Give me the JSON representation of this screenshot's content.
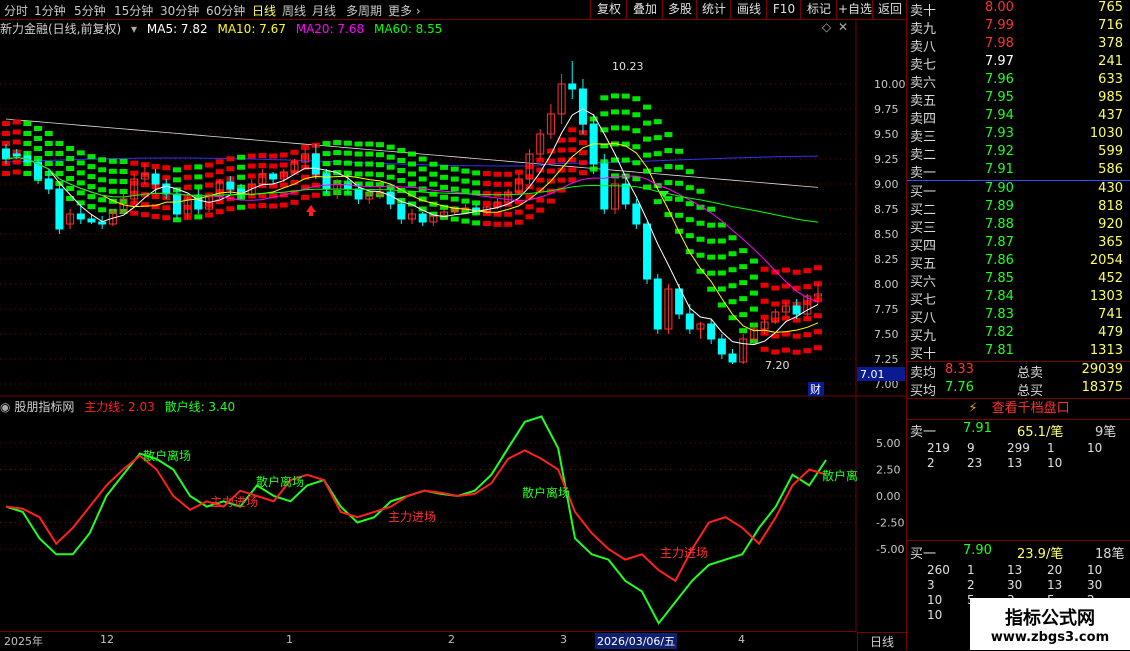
{
  "toolbar": {
    "periods": [
      "分时",
      "1分钟",
      "5分钟",
      "15分钟",
      "30分钟",
      "60分钟",
      "日线",
      "周线",
      "月线",
      "多周期",
      "更多"
    ],
    "active": "日线",
    "right_buttons": [
      "复权",
      "叠加",
      "多股",
      "统计",
      "画线",
      "F10",
      "标记",
      "+自选",
      "返回"
    ]
  },
  "title": {
    "stock": "新力金融(日线,前复权)",
    "ma5": "MA5: 7.82",
    "ma10": "MA10: 7.67",
    "ma20": "MA20: 7.68",
    "ma60": "MA60: 8.55"
  },
  "colors": {
    "up": "#ff3232",
    "down": "#00ffff",
    "ma5": "#ffffff",
    "ma10": "#ffff00",
    "ma20": "#ff00ff",
    "ma60": "#00ff00",
    "grid": "#7a0000",
    "line_main": "#ff2020",
    "line_retail": "#20ff20",
    "ribbon_green": "#00ff00",
    "ribbon_red": "#ff0000"
  },
  "price_axis": {
    "ticks": [
      "10.00",
      "9.75",
      "9.50",
      "9.25",
      "9.00",
      "8.75",
      "8.50",
      "8.25",
      "8.00",
      "7.75",
      "7.50",
      "7.25",
      "7.00"
    ],
    "current": "7.01"
  },
  "annotations": {
    "high": "10.23",
    "low": "7.20",
    "cai": "财"
  },
  "indicator": {
    "title": "股朋指标网",
    "main_label": "主力线: 2.03",
    "retail_label": "散户线: 3.40",
    "ticks": [
      "5.00",
      "2.50",
      "0.00",
      "-2.50",
      "-5.00"
    ],
    "labels": [
      {
        "text": "散户离场"
      },
      {
        "text": "主力进场"
      },
      {
        "text": "散户离场"
      },
      {
        "text": "主力进场"
      },
      {
        "text": "散户离场"
      },
      {
        "text": "主力进场"
      },
      {
        "text": "散户离"
      }
    ]
  },
  "xaxis": {
    "labels": [
      "2025年",
      "12",
      "1",
      "2",
      "3",
      "2026/03/06/五",
      "4"
    ],
    "period": "日线"
  },
  "orderbook": {
    "asks": [
      {
        "label": "卖十",
        "price": "8.00",
        "vol": "765"
      },
      {
        "label": "卖九",
        "price": "7.99",
        "vol": "716"
      },
      {
        "label": "卖八",
        "price": "7.98",
        "vol": "378"
      },
      {
        "label": "卖七",
        "price": "7.97",
        "vol": "241"
      },
      {
        "label": "卖六",
        "price": "7.96",
        "vol": "633"
      },
      {
        "label": "卖五",
        "price": "7.95",
        "vol": "985"
      },
      {
        "label": "卖四",
        "price": "7.94",
        "vol": "437"
      },
      {
        "label": "卖三",
        "price": "7.93",
        "vol": "1030"
      },
      {
        "label": "卖二",
        "price": "7.92",
        "vol": "599"
      },
      {
        "label": "卖一",
        "price": "7.91",
        "vol": "586"
      }
    ],
    "bids": [
      {
        "label": "买一",
        "price": "7.90",
        "vol": "430"
      },
      {
        "label": "买二",
        "price": "7.89",
        "vol": "818"
      },
      {
        "label": "买三",
        "price": "7.88",
        "vol": "920"
      },
      {
        "label": "买四",
        "price": "7.87",
        "vol": "365"
      },
      {
        "label": "买五",
        "price": "7.86",
        "vol": "2054"
      },
      {
        "label": "买六",
        "price": "7.85",
        "vol": "452"
      },
      {
        "label": "买七",
        "price": "7.84",
        "vol": "1303"
      },
      {
        "label": "买八",
        "price": "7.83",
        "vol": "741"
      },
      {
        "label": "买九",
        "price": "7.82",
        "vol": "479"
      },
      {
        "label": "买十",
        "price": "7.81",
        "vol": "1313"
      }
    ],
    "avg_sell": {
      "label": "卖均",
      "price": "8.33",
      "total_label": "总卖",
      "total": "29039"
    },
    "avg_buy": {
      "label": "买均",
      "price": "7.76",
      "total_label": "总买",
      "total": "18375"
    },
    "view_button": "查看千档盘口",
    "sell1_summary": {
      "label": "卖一",
      "price": "7.91",
      "per": "65.1/笔",
      "count": "9笔"
    },
    "sell1_orders": [
      "219",
      "9",
      "299",
      "1",
      "10",
      "2",
      "23",
      "13",
      "10"
    ],
    "buy1_summary": {
      "label": "买一",
      "price": "7.90",
      "per": "23.9/笔",
      "count": "18笔"
    },
    "buy1_orders": [
      "260",
      "1",
      "13",
      "20",
      "10",
      "3",
      "2",
      "30",
      "13",
      "30",
      "10",
      "5",
      "3",
      "5",
      "2",
      "10"
    ]
  },
  "watermark": {
    "line1": "指标公式网",
    "line2": "www.zbgs3.com"
  },
  "chart_data": {
    "type": "candlestick",
    "title": "新力金融(日线,前复权)",
    "ylim": [
      7.0,
      10.3
    ],
    "candles": [
      [
        9.35,
        9.4,
        9.25,
        9.2
      ],
      [
        9.3,
        9.35,
        9.28,
        9.25
      ],
      [
        9.28,
        9.32,
        9.22,
        9.18
      ],
      [
        9.22,
        9.25,
        9.05,
        9.0
      ],
      [
        9.05,
        9.15,
        8.95,
        8.9
      ],
      [
        8.95,
        9.0,
        8.55,
        8.5
      ],
      [
        8.6,
        8.75,
        8.7,
        8.55
      ],
      [
        8.7,
        8.8,
        8.65,
        8.6
      ],
      [
        8.65,
        8.7,
        8.62,
        8.6
      ],
      [
        8.62,
        8.68,
        8.6,
        8.55
      ],
      [
        8.6,
        8.75,
        8.72,
        8.58
      ],
      [
        8.72,
        8.9,
        8.85,
        8.7
      ],
      [
        8.85,
        9.1,
        9.05,
        8.8
      ],
      [
        9.05,
        9.2,
        9.1,
        9.0
      ],
      [
        9.1,
        9.15,
        9.0,
        8.9
      ],
      [
        9.0,
        9.05,
        8.9,
        8.85
      ],
      [
        8.9,
        8.95,
        8.7,
        8.65
      ],
      [
        8.7,
        8.9,
        8.85,
        8.65
      ],
      [
        8.85,
        8.95,
        8.75,
        8.7
      ],
      [
        8.75,
        8.9,
        8.88,
        8.72
      ],
      [
        8.88,
        9.05,
        9.02,
        8.85
      ],
      [
        9.02,
        9.08,
        8.95,
        8.9
      ],
      [
        8.95,
        9.0,
        8.9,
        8.85
      ],
      [
        8.9,
        9.05,
        9.0,
        8.88
      ],
      [
        9.0,
        9.15,
        9.1,
        8.98
      ],
      [
        9.1,
        9.12,
        9.05,
        9.0
      ],
      [
        9.05,
        9.15,
        9.12,
        9.02
      ],
      [
        9.12,
        9.25,
        9.22,
        9.1
      ],
      [
        9.22,
        9.35,
        9.3,
        9.15
      ],
      [
        9.3,
        9.4,
        9.1,
        9.05
      ],
      [
        9.1,
        9.15,
        8.95,
        8.9
      ],
      [
        8.95,
        9.05,
        9.0,
        8.85
      ],
      [
        9.0,
        9.1,
        8.95,
        8.9
      ],
      [
        8.95,
        9.0,
        8.85,
        8.8
      ],
      [
        8.85,
        8.95,
        8.9,
        8.8
      ],
      [
        8.9,
        9.0,
        8.92,
        8.85
      ],
      [
        8.92,
        8.95,
        8.8,
        8.75
      ],
      [
        8.8,
        8.85,
        8.65,
        8.6
      ],
      [
        8.65,
        8.75,
        8.7,
        8.6
      ],
      [
        8.7,
        8.72,
        8.62,
        8.58
      ],
      [
        8.62,
        8.7,
        8.68,
        8.58
      ],
      [
        8.68,
        8.75,
        8.72,
        8.65
      ],
      [
        8.72,
        8.78,
        8.74,
        8.7
      ],
      [
        8.74,
        8.8,
        8.76,
        8.72
      ],
      [
        8.76,
        8.8,
        8.73,
        8.7
      ],
      [
        8.73,
        8.78,
        8.77,
        8.7
      ],
      [
        8.77,
        8.85,
        8.82,
        8.75
      ],
      [
        8.82,
        8.95,
        8.92,
        8.8
      ],
      [
        8.92,
        9.1,
        9.05,
        8.9
      ],
      [
        9.05,
        9.35,
        9.3,
        9.0
      ],
      [
        9.3,
        9.55,
        9.5,
        9.25
      ],
      [
        9.5,
        9.8,
        9.7,
        9.45
      ],
      [
        9.7,
        10.1,
        10.0,
        9.6
      ],
      [
        10.0,
        10.23,
        9.95,
        9.85
      ],
      [
        9.95,
        10.05,
        9.6,
        9.5
      ],
      [
        9.6,
        9.7,
        9.2,
        9.1
      ],
      [
        9.2,
        9.3,
        8.75,
        8.7
      ],
      [
        8.75,
        9.05,
        9.0,
        8.7
      ],
      [
        9.0,
        9.1,
        8.8,
        8.75
      ],
      [
        8.8,
        8.85,
        8.6,
        8.55
      ],
      [
        8.6,
        8.62,
        8.05,
        8.0
      ],
      [
        8.05,
        8.1,
        7.55,
        7.5
      ],
      [
        7.55,
        8.0,
        7.95,
        7.5
      ],
      [
        7.95,
        8.0,
        7.7,
        7.65
      ],
      [
        7.7,
        7.8,
        7.55,
        7.5
      ],
      [
        7.55,
        7.62,
        7.6,
        7.45
      ],
      [
        7.6,
        7.65,
        7.45,
        7.4
      ],
      [
        7.45,
        7.5,
        7.3,
        7.25
      ],
      [
        7.3,
        7.35,
        7.22,
        7.2
      ],
      [
        7.22,
        7.5,
        7.45,
        7.2
      ],
      [
        7.45,
        7.6,
        7.55,
        7.4
      ],
      [
        7.55,
        7.65,
        7.62,
        7.5
      ],
      [
        7.62,
        7.75,
        7.72,
        7.6
      ],
      [
        7.72,
        7.82,
        7.78,
        7.68
      ],
      [
        7.78,
        7.85,
        7.7,
        7.65
      ],
      [
        7.7,
        7.9,
        7.88,
        7.68
      ],
      [
        7.88,
        8.0,
        7.9,
        7.8
      ]
    ]
  }
}
